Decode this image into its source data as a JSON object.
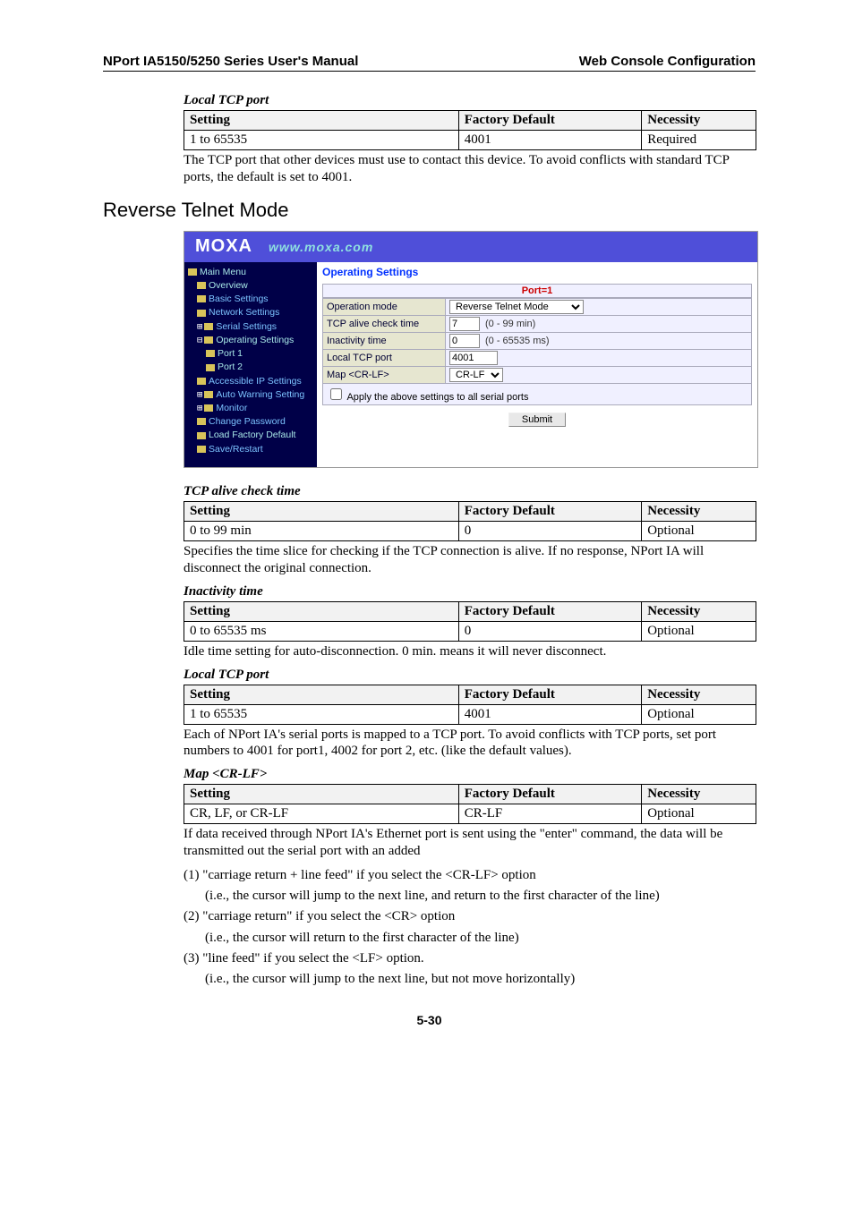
{
  "header": {
    "left": "NPort IA5150/5250 Series User's Manual",
    "right": "Web Console Configuration"
  },
  "section1": {
    "title": "Local TCP port",
    "cols": {
      "c1": "Setting",
      "c2": "Factory Default",
      "c3": "Necessity"
    },
    "row": {
      "c1": "1 to 65535",
      "c2": "4001",
      "c3": "Required"
    },
    "desc": "The TCP port that other devices must use to contact this device. To avoid conflicts with standard TCP ports, the default is set to 4001."
  },
  "h2": "Reverse Telnet Mode",
  "screenshot": {
    "logo": "MOXA",
    "url": "www.moxa.com",
    "nav": {
      "main": "Main Menu",
      "overview": "Overview",
      "basic": "Basic Settings",
      "network": "Network Settings",
      "serial": "Serial Settings",
      "operating": "Operating Settings",
      "port1": "Port 1",
      "port2": "Port 2",
      "accessible": "Accessible IP Settings",
      "autowarn": "Auto Warning Setting",
      "monitor": "Monitor",
      "changepw": "Change Password",
      "loadfactory": "Load Factory Default",
      "saverestart": "Save/Restart"
    },
    "main": {
      "title": "Operating Settings",
      "porthdr": "Port=1",
      "rows": {
        "opmode_lbl": "Operation mode",
        "opmode_val": "Reverse Telnet Mode",
        "tcpalive_lbl": "TCP alive check time",
        "tcpalive_val": "7",
        "tcpalive_range": "(0 - 99 min)",
        "inact_lbl": "Inactivity time",
        "inact_val": "0",
        "inact_range": "(0 - 65535 ms)",
        "localtcp_lbl": "Local TCP port",
        "localtcp_val": "4001",
        "map_lbl": "Map <CR-LF>",
        "map_val": "CR-LF"
      },
      "apply": "Apply the above settings to all serial ports",
      "submit": "Submit"
    }
  },
  "sec_tcpalive": {
    "title": "TCP alive check time",
    "cols": {
      "c1": "Setting",
      "c2": "Factory Default",
      "c3": "Necessity"
    },
    "row": {
      "c1": "0 to 99 min",
      "c2": "0",
      "c3": "Optional"
    },
    "desc": "Specifies the time slice for checking if the TCP connection is alive. If no response, NPort IA will disconnect the original connection."
  },
  "sec_inact": {
    "title": "Inactivity time",
    "cols": {
      "c1": "Setting",
      "c2": "Factory Default",
      "c3": "Necessity"
    },
    "row": {
      "c1": "0 to 65535 ms",
      "c2": "0",
      "c3": "Optional"
    },
    "desc": "Idle time setting for auto-disconnection. 0 min. means it will never disconnect."
  },
  "sec_localtcp": {
    "title": "Local TCP port",
    "cols": {
      "c1": "Setting",
      "c2": "Factory Default",
      "c3": "Necessity"
    },
    "row": {
      "c1": "1 to 65535",
      "c2": "4001",
      "c3": "Optional"
    },
    "desc": "Each of NPort IA's serial ports is mapped to a TCP port. To avoid conflicts with TCP ports, set port numbers to 4001 for port1, 4002 for port 2, etc. (like the default values)."
  },
  "sec_map": {
    "title": "Map <CR-LF>",
    "cols": {
      "c1": "Setting",
      "c2": "Factory Default",
      "c3": "Necessity"
    },
    "row": {
      "c1": "CR, LF, or CR-LF",
      "c2": "CR-LF",
      "c3": "Optional"
    },
    "desc": "If data received through NPort IA's Ethernet port is sent using the \"enter\" command, the data will be transmitted out the serial port with an added"
  },
  "list": {
    "l1a": "(1)  \"carriage return + line feed\" if you select the <CR-LF> option",
    "l1b": "(i.e., the cursor will jump to the next line, and return to the first character of the line)",
    "l2a": "(2)  \"carriage return\" if you select the <CR> option",
    "l2b": "(i.e., the cursor will return to the first character of the line)",
    "l3a": "(3)  \"line feed\" if you select the <LF> option.",
    "l3b": "(i.e., the cursor will jump to the next line, but not move horizontally)"
  },
  "pagenum": "5-30"
}
